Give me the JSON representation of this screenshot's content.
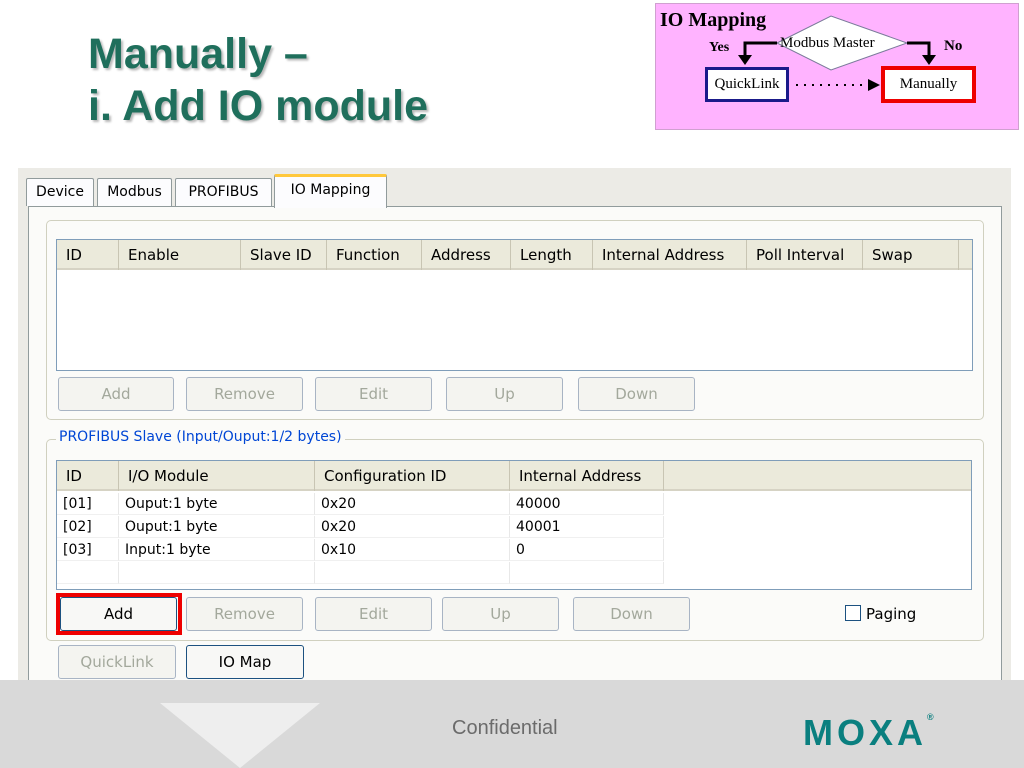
{
  "slide": {
    "title_line1": "Manually –",
    "title_line2": "i. Add IO module"
  },
  "flow": {
    "title": "IO Mapping",
    "decision": "Modbus Master",
    "yes": "Yes",
    "no": "No",
    "left_box": "QuickLink",
    "right_box": "Manually"
  },
  "dialog": {
    "tabs": [
      "Device",
      "Modbus",
      "PROFIBUS",
      "IO Mapping"
    ],
    "active_tab": "IO Mapping",
    "modbus_table": {
      "columns": [
        "ID",
        "Enable",
        "Slave ID",
        "Function",
        "Address",
        "Length",
        "Internal Address",
        "Poll Interval",
        "Swap"
      ],
      "rows": []
    },
    "modbus_buttons": {
      "add": "Add",
      "remove": "Remove",
      "edit": "Edit",
      "up": "Up",
      "down": "Down"
    },
    "profibus_group": {
      "legend": "PROFIBUS Slave (Input/Ouput:1/2 bytes)",
      "columns": [
        "ID",
        "I/O Module",
        "Configuration ID",
        "Internal Address"
      ],
      "rows": [
        [
          "[01]",
          "Ouput:1 byte",
          "0x20",
          "40000"
        ],
        [
          "[02]",
          "Ouput:1 byte",
          "0x20",
          "40001"
        ],
        [
          "[03]",
          "Input:1 byte",
          "0x10",
          "0"
        ]
      ]
    },
    "profibus_buttons": {
      "add": "Add",
      "remove": "Remove",
      "edit": "Edit",
      "up": "Up",
      "down": "Down"
    },
    "paging_label": "Paging",
    "paging_checked": false,
    "bottom_buttons": {
      "quicklink": "QuickLink",
      "io_map": "IO Map"
    }
  },
  "footer": {
    "confidential": "Confidential",
    "logo": "MOXA",
    "logo_mark": "®"
  },
  "colors": {
    "title": "#1f6f5c",
    "flow_bg": "#ffb3ff",
    "highlight": "#ee0000",
    "legend": "#0046d5",
    "logo": "#0a7f7f"
  }
}
